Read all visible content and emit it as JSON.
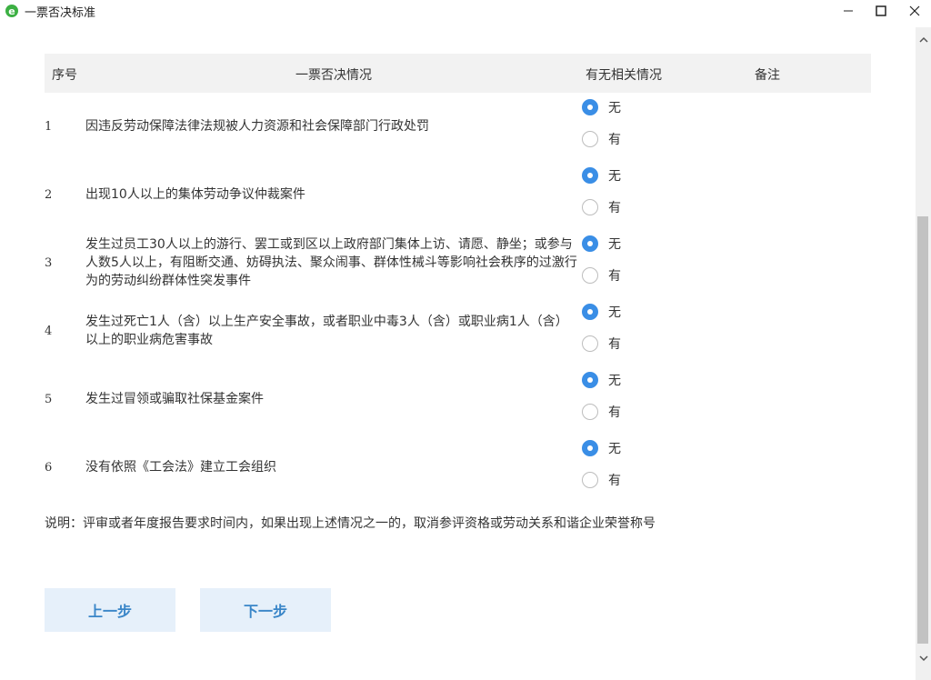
{
  "window": {
    "title": "一票否决标准",
    "accent_color": "#3a8ee6"
  },
  "table": {
    "headers": {
      "no": "序号",
      "description": "一票否决情况",
      "status": "有无相关情况",
      "remark": "备注"
    },
    "rows": [
      {
        "no": "1",
        "description": "因违反劳动保障法律法规被人力资源和社会保障部门行政处罚",
        "option_none": "无",
        "option_yes": "有",
        "selected": "无"
      },
      {
        "no": "2",
        "description": "出现10人以上的集体劳动争议仲裁案件",
        "option_none": "无",
        "option_yes": "有",
        "selected": "无"
      },
      {
        "no": "3",
        "description": "发生过员工30人以上的游行、罢工或到区以上政府部门集体上访、请愿、静坐；或参与人数5人以上，有阻断交通、妨碍执法、聚众闹事、群体性械斗等影响社会秩序的过激行为的劳动纠纷群体性突发事件",
        "option_none": "无",
        "option_yes": "有",
        "selected": "无"
      },
      {
        "no": "4",
        "description": "发生过死亡1人（含）以上生产安全事故，或者职业中毒3人（含）或职业病1人（含）以上的职业病危害事故",
        "option_none": "无",
        "option_yes": "有",
        "selected": "无"
      },
      {
        "no": "5",
        "description": "发生过冒领或骗取社保基金案件",
        "option_none": "无",
        "option_yes": "有",
        "selected": "无"
      },
      {
        "no": "6",
        "description": "没有依照《工会法》建立工会组织",
        "option_none": "无",
        "option_yes": "有",
        "selected": "无"
      }
    ]
  },
  "note": "说明：评审或者年度报告要求时间内，如果出现上述情况之一的，取消参评资格或劳动关系和谐企业荣誉称号",
  "buttons": {
    "prev": "上一步",
    "next": "下一步"
  }
}
